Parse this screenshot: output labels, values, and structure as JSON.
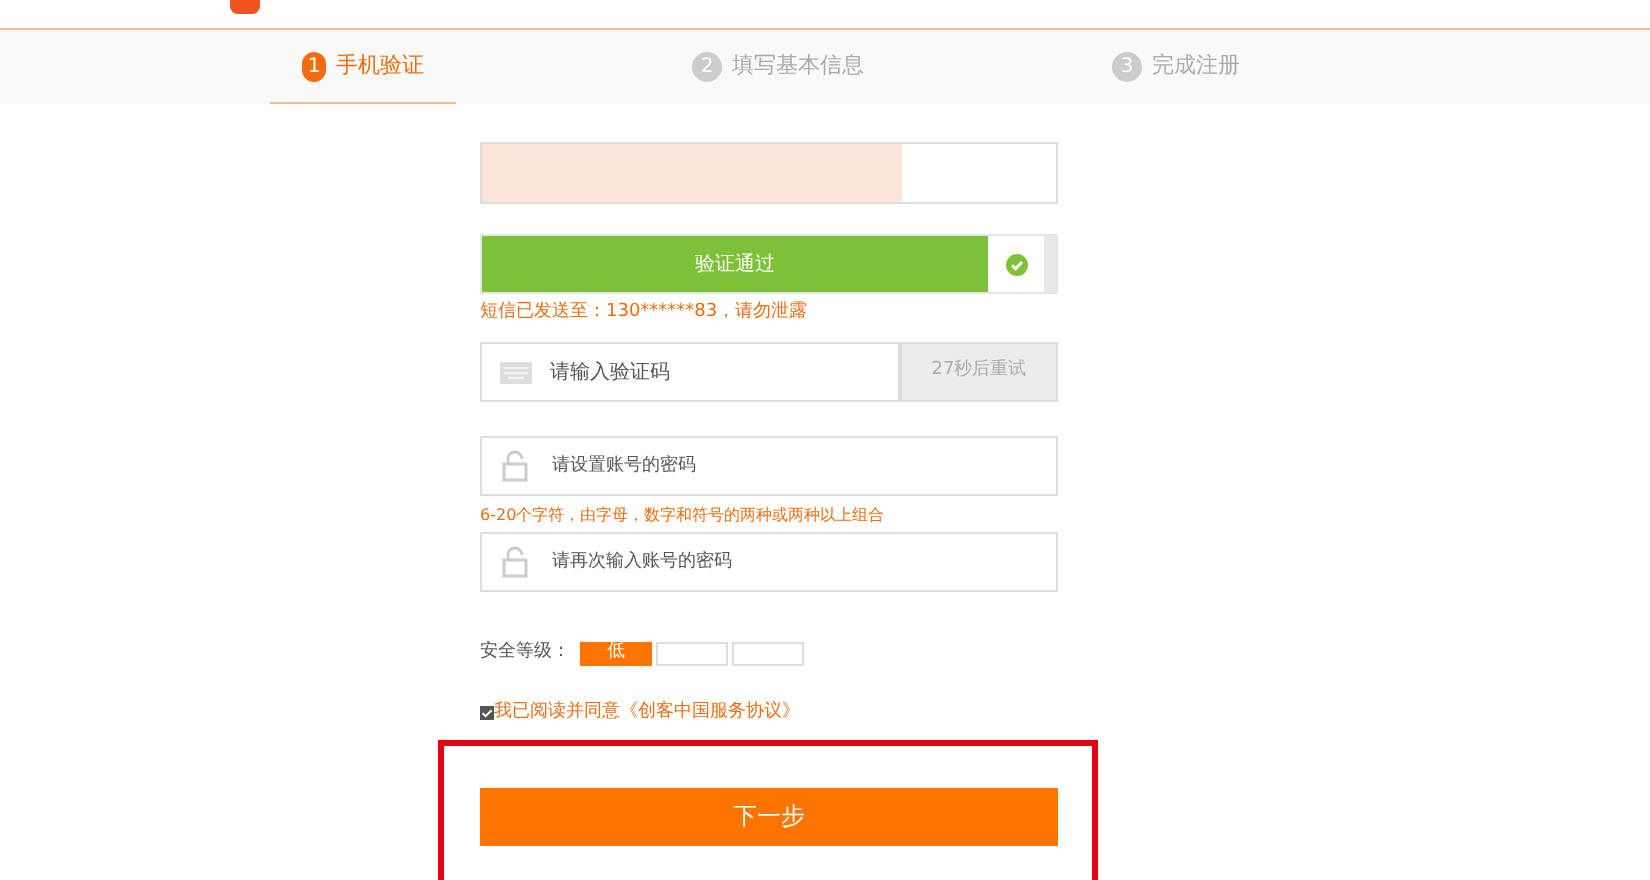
{
  "steps": [
    {
      "number": "1",
      "label": "手机验证",
      "selected": true
    },
    {
      "number": "2",
      "label": "填写基本信息",
      "selected": false
    },
    {
      "number": "3",
      "label": "完成注册",
      "selected": false
    }
  ],
  "phone_field": {
    "highlighted": true
  },
  "slider": {
    "label": "验证通过",
    "verified": true
  },
  "sms_notice": "短信已发送至：130******83，请勿泄露",
  "code_field": {
    "placeholder": "请输入验证码",
    "button": "27秒后重试",
    "disabled": true
  },
  "password_field": {
    "placeholder": "请设置账号的密码"
  },
  "password_hint": "6-20个字符，由字母，数字和符号的两种或两种以上组合",
  "confirm_field": {
    "placeholder": "请再次输入账号的密码"
  },
  "security": {
    "label": "安全等级：",
    "segments": [
      {
        "text": "低",
        "on": true
      },
      {
        "on": false
      },
      {
        "on": false
      }
    ]
  },
  "agreement": {
    "text": "我已阅读并同意《创客中国服务协议》",
    "checked": true
  },
  "next_button": "下一步"
}
